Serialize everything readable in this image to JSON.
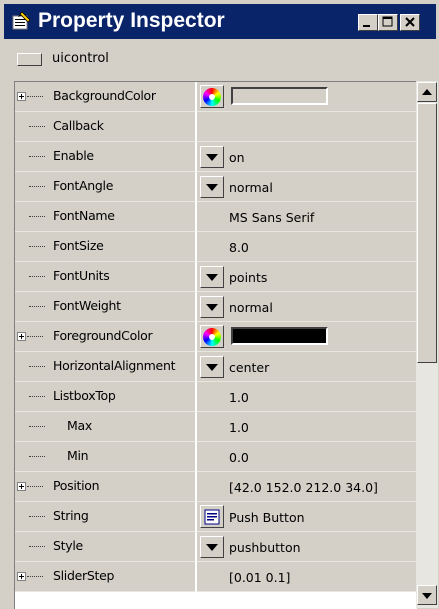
{
  "window": {
    "title": "Property Inspector",
    "object_label": "uicontrol",
    "controls": {
      "minimize": "minimize",
      "maximize": "maximize",
      "close": "close"
    }
  },
  "properties": [
    {
      "name": "BackgroundColor",
      "expandable": true,
      "editor": "color",
      "value": "",
      "swatch_color": "#d4d0c8"
    },
    {
      "name": "Callback",
      "expandable": false,
      "editor": "text",
      "value": ""
    },
    {
      "name": "Enable",
      "expandable": false,
      "editor": "dropdown",
      "value": "on"
    },
    {
      "name": "FontAngle",
      "expandable": false,
      "editor": "dropdown",
      "value": "normal"
    },
    {
      "name": "FontName",
      "expandable": false,
      "editor": "text",
      "value": "MS Sans Serif"
    },
    {
      "name": "FontSize",
      "expandable": false,
      "editor": "text",
      "value": "8.0"
    },
    {
      "name": "FontUnits",
      "expandable": false,
      "editor": "dropdown",
      "value": "points"
    },
    {
      "name": "FontWeight",
      "expandable": false,
      "editor": "dropdown",
      "value": "normal"
    },
    {
      "name": "ForegroundColor",
      "expandable": true,
      "editor": "color",
      "value": "",
      "swatch_color": "#000000"
    },
    {
      "name": "HorizontalAlignment",
      "expandable": false,
      "editor": "dropdown",
      "value": "center"
    },
    {
      "name": "ListboxTop",
      "expandable": false,
      "editor": "text",
      "value": "1.0"
    },
    {
      "name": "Max",
      "expandable": false,
      "editor": "text",
      "value": "1.0",
      "indent": true
    },
    {
      "name": "Min",
      "expandable": false,
      "editor": "text",
      "value": "0.0",
      "indent": true
    },
    {
      "name": "Position",
      "expandable": true,
      "editor": "text",
      "value": "[42.0 152.0 212.0 34.0]"
    },
    {
      "name": "String",
      "expandable": false,
      "editor": "edit",
      "value": "Push Button"
    },
    {
      "name": "Style",
      "expandable": false,
      "editor": "dropdown",
      "value": "pushbutton"
    },
    {
      "name": "SliderStep",
      "expandable": true,
      "editor": "text",
      "value": "[0.01 0.1]"
    }
  ],
  "colors": {
    "titlebar": "#0a246a",
    "face": "#d4d0c8"
  }
}
